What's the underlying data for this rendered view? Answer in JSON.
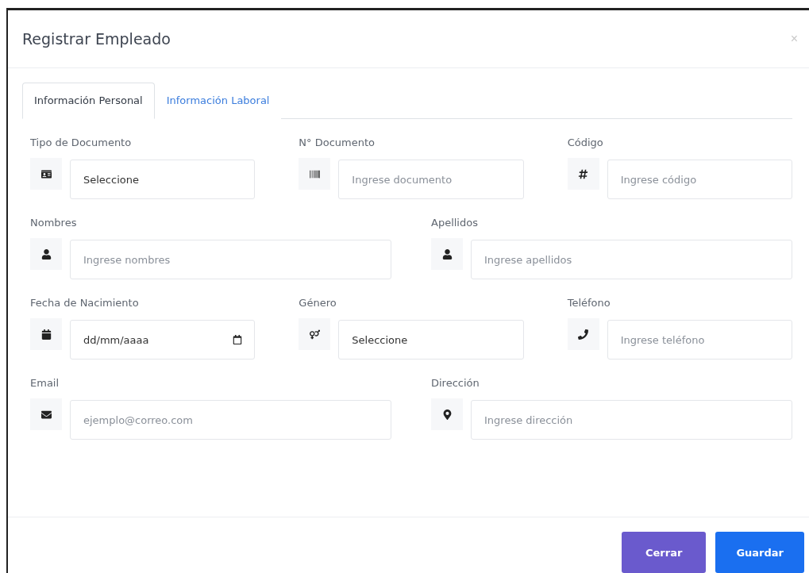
{
  "modal": {
    "title": "Registrar Empleado",
    "close": "×"
  },
  "tabs": [
    {
      "label": "Información Personal",
      "selected": true
    },
    {
      "label": "Información Laboral",
      "selected": false
    }
  ],
  "rows": [
    {
      "fields": [
        {
          "label": "Tipo de Documento",
          "kind": "select",
          "value": "Seleccione"
        },
        {
          "label": "N° Documento",
          "kind": "text",
          "placeholder": "Ingrese documento"
        },
        {
          "label": "Código",
          "kind": "text",
          "placeholder": "Ingrese código"
        }
      ]
    },
    {
      "fields": [
        {
          "label": "Nombres",
          "kind": "text",
          "placeholder": "Ingrese nombres"
        },
        {
          "label": "Apellidos",
          "kind": "text",
          "placeholder": "Ingrese apellidos"
        }
      ]
    },
    {
      "fields": [
        {
          "label": "Fecha de Nacimiento",
          "kind": "date",
          "placeholder": "dd/mm/aaaa"
        },
        {
          "label": "Género",
          "kind": "select",
          "value": "Seleccione"
        },
        {
          "label": "Teléfono",
          "kind": "text",
          "placeholder": "Ingrese teléfono"
        }
      ]
    },
    {
      "fields": [
        {
          "label": "Email",
          "kind": "text",
          "placeholder": "ejemplo@correo.com"
        },
        {
          "label": "Dirección",
          "kind": "text",
          "placeholder": "Ingrese dirección"
        }
      ]
    }
  ],
  "buttons": [
    {
      "label": "Cerrar",
      "kind": "secondary"
    },
    {
      "label": "Guardar",
      "kind": "primary"
    }
  ]
}
